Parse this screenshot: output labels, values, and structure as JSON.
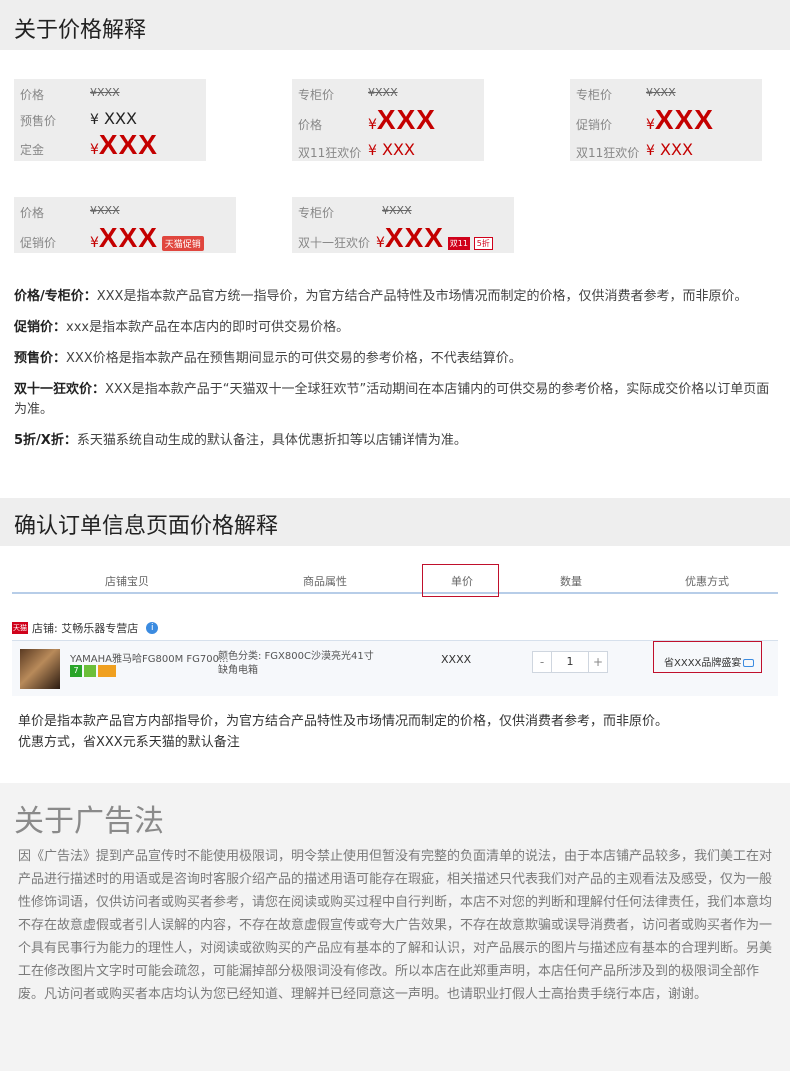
{
  "sec1": {
    "title": "关于价格解释"
  },
  "cards": {
    "c1": {
      "r1_label": "价格",
      "r1_val": "¥XXX",
      "r2_label": "预售价",
      "r2_yen": "¥",
      "r2_val": "XXX",
      "r3_label": "定金",
      "r3_yen": "¥",
      "r3_val": "XXX"
    },
    "c2": {
      "r1_label": "专柜价",
      "r1_val": "¥XXX",
      "r2_label": "价格",
      "r2_yen": "¥",
      "r2_val": "XXX",
      "r3_label": "双11狂欢价",
      "r3_yen": "¥",
      "r3_val": "XXX"
    },
    "c3": {
      "r1_label": "专柜价",
      "r1_val": "¥XXX",
      "r2_label": "促销价",
      "r2_yen": "¥",
      "r2_val": "XXX",
      "r3_label": "双11狂欢价",
      "r3_yen": "¥",
      "r3_val": "XXX"
    },
    "c4": {
      "r1_label": "价格",
      "r1_val": "¥XXX",
      "r2_label": "促销价",
      "r2_yen": "¥",
      "r2_val": "XXX",
      "tag": "天猫促销"
    },
    "c5": {
      "r1_label": "专柜价",
      "r1_val": "¥XXX",
      "r2_label": "双十一狂欢价",
      "r2_yen": "¥",
      "r2_val": "XXX",
      "tag1": "双11",
      "tag2": "5折"
    }
  },
  "defs": [
    {
      "term": "价格/专柜价：",
      "text": "XXX是指本款产品官方统一指导价，为官方结合产品特性及市场情况而制定的价格，仅供消费者参考，而非原价。"
    },
    {
      "term": "促销价：",
      "text": "xxx是指本款产品在本店内的即时可供交易价格。"
    },
    {
      "term": "预售价：",
      "text": "XXX价格是指本款产品在预售期间显示的可供交易的参考价格，不代表结算价。"
    },
    {
      "term": "双十一狂欢价：",
      "text": "XXX是指本款产品于“天猫双十一全球狂欢节”活动期间在本店铺内的可供交易的参考价格，实际成交价格以订单页面为准。"
    },
    {
      "term": "5折/X折：",
      "text": "系天猫系统自动生成的默认备注，具体优惠折扣等以店铺详情为准。"
    }
  ],
  "sec2": {
    "title": "确认订单信息页面价格解释"
  },
  "table": {
    "headers": [
      "店铺宝贝",
      "商品属性",
      "单价",
      "数量",
      "优惠方式"
    ],
    "shop_logo": "天猫",
    "shop_name": "店铺: 艾畅乐器专营店",
    "info_icon": "i",
    "product_name": "YAMAHA雅马哈FG800M FG700...",
    "attr_line1": "颜色分类: FGX800C沙漠亮光41寸",
    "attr_line2": "缺角电箱",
    "unit_price": "XXXX",
    "minus": "-",
    "qty": "1",
    "plus": "+",
    "promo": "省XXXX品牌盛宴",
    "icon_labels": [
      "7",
      "",
      ""
    ]
  },
  "note": {
    "line1": "单价是指本款产品官方内部指导价，为官方结合产品特性及市场情况而制定的价格，仅供消费者参考，而非原价。",
    "line2": "优惠方式，省XXX元系天猫的默认备注"
  },
  "law": {
    "title": "关于广告法",
    "text": "因《广告法》提到产品宣传时不能使用极限词，明令禁止使用但暂没有完整的负面清单的说法，由于本店铺产品较多，我们美工在对产品进行描述时的用语或是咨询时客服介绍产品的描述用语可能存在瑕疵，相关描述只代表我们对产品的主观看法及感受，仅为一般性修饰词语，仅供访问者或购买者参考，请您在阅读或购买过程中自行判断，本店不对您的判断和理解付任何法律责任，我们本意均不存在故意虚假或者引人误解的内容，不存在故意虚假宣传或夸大广告效果，不存在故意欺骗或误导消费者，访问者或购买者作为一个具有民事行为能力的理性人，对阅读或欲购买的产品应有基本的了解和认识，对产品展示的图片与描述应有基本的合理判断。另美工在修改图片文字时可能会疏忽，可能漏掉部分极限词没有修改。所以本店在此郑重声明，本店任何产品所涉及到的极限词全部作废。凡访问者或购买者本店均认为您已经知道、理解并已经同意这一声明。也请职业打假人士高抬贵手绕行本店，谢谢。"
  },
  "colors": {
    "price_red": "#c40000",
    "highlight_box": "#c0102c",
    "table_rule": "#b7cde8"
  }
}
